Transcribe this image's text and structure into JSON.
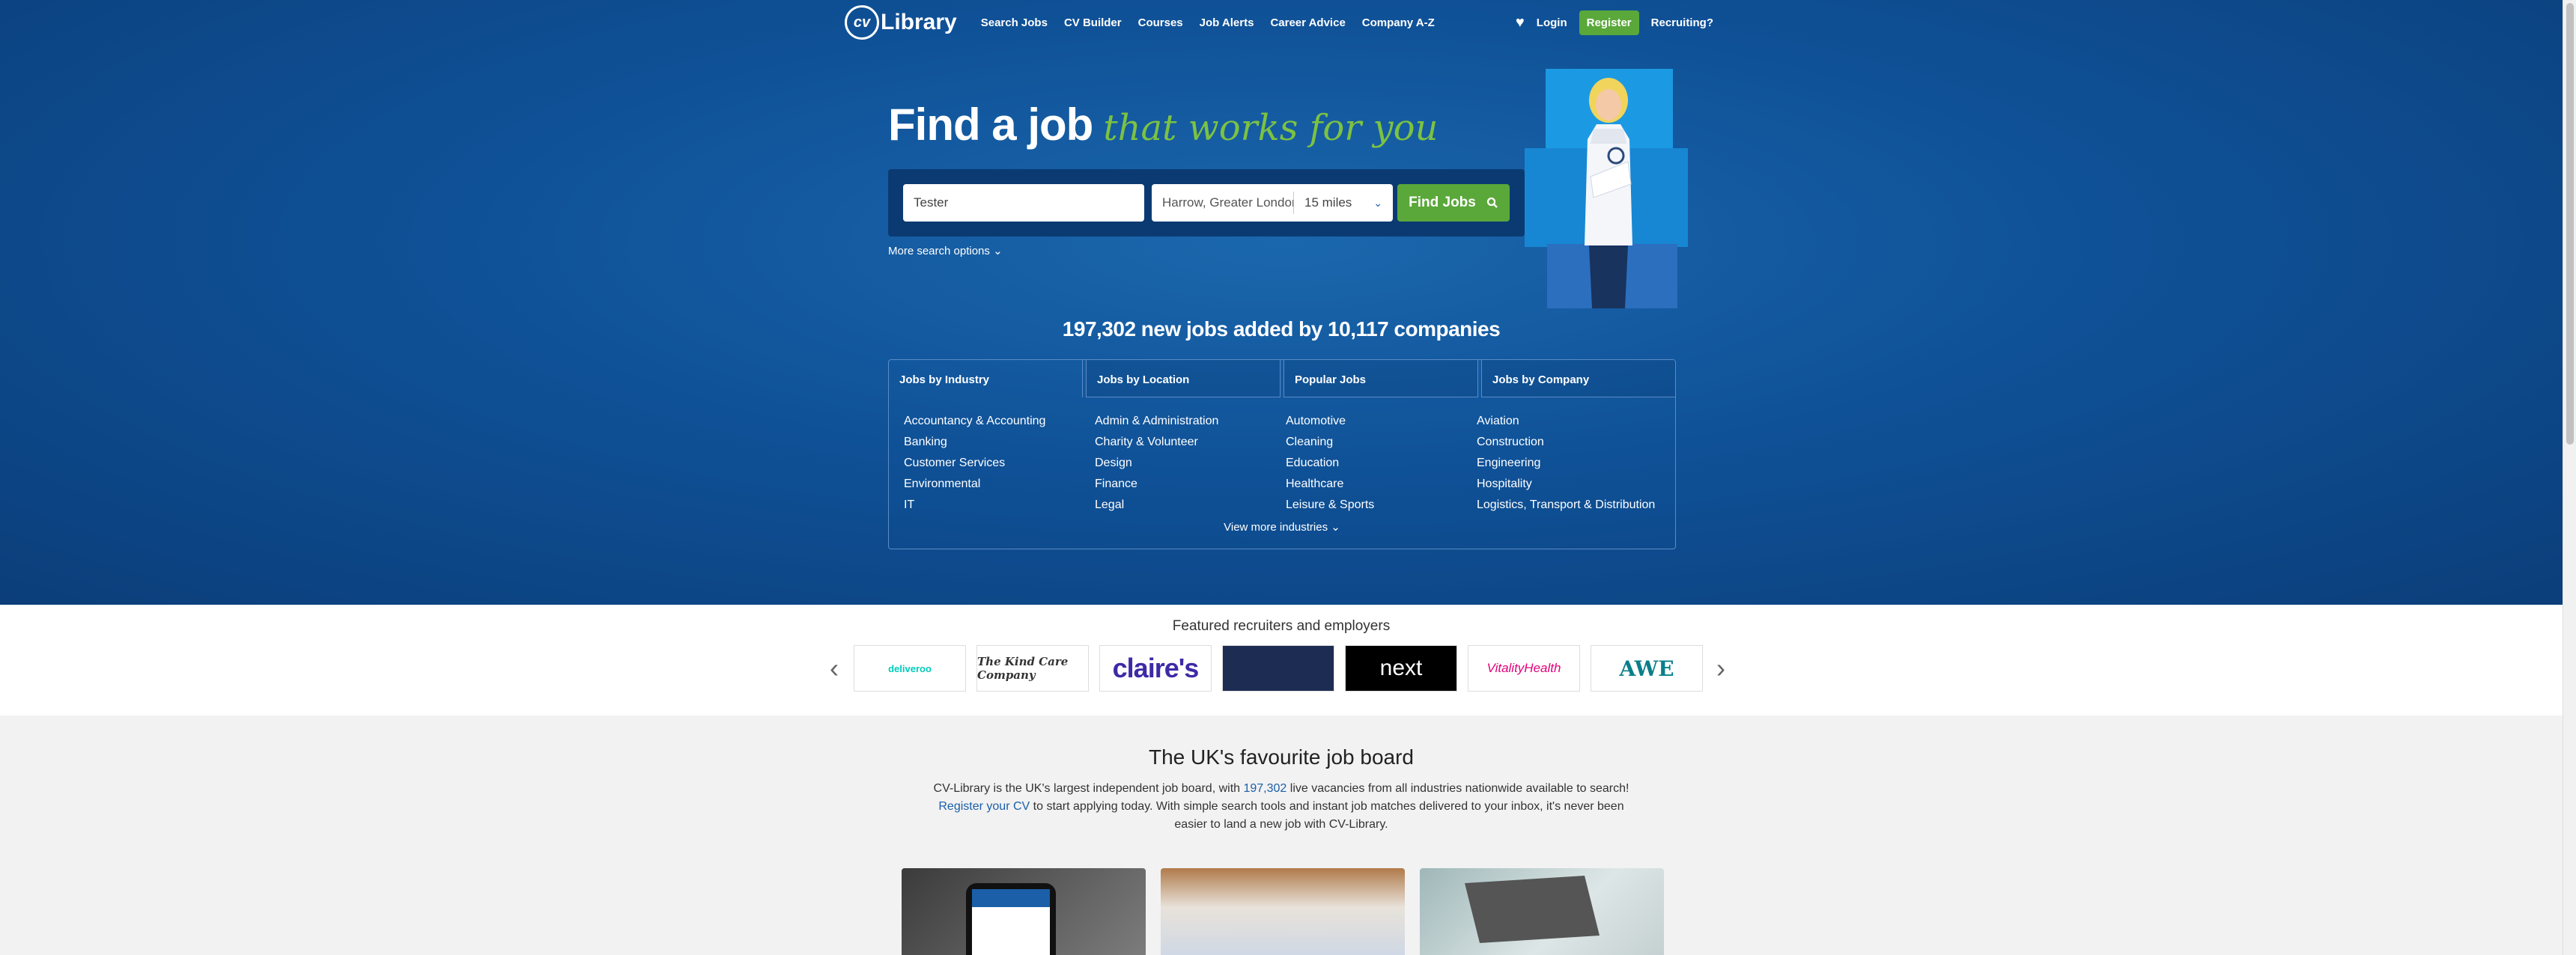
{
  "nav": {
    "logo": "Library",
    "logo_badge": "cv",
    "links": [
      "Search Jobs",
      "CV Builder",
      "Courses",
      "Job Alerts",
      "Career Advice",
      "Company A-Z"
    ],
    "login": "Login",
    "register": "Register",
    "recruiting": "Recruiting?"
  },
  "hero": {
    "title": "Find a job",
    "title_accent": "that works for you",
    "keyword_value": "Tester",
    "location_value": "Harrow, Greater London",
    "radius_value": "15 miles",
    "find_button": "Find Jobs",
    "more_options": "More search options"
  },
  "count_text": "197,302 new jobs added by 10,117 companies",
  "tabs": [
    "Jobs by Industry",
    "Jobs by Location",
    "Popular Jobs",
    "Jobs by Company"
  ],
  "industries": [
    [
      "Accountancy & Accounting",
      "Banking",
      "Customer Services",
      "Environmental",
      "IT"
    ],
    [
      "Admin & Administration",
      "Charity & Volunteer",
      "Design",
      "Finance",
      "Legal"
    ],
    [
      "Automotive",
      "Cleaning",
      "Education",
      "Healthcare",
      "Leisure & Sports"
    ],
    [
      "Aviation",
      "Construction",
      "Engineering",
      "Hospitality",
      "Logistics, Transport & Distribution"
    ]
  ],
  "view_more": "View more industries",
  "featured": {
    "title": "Featured recruiters and employers",
    "logos": [
      "deliveroo",
      "The Kind Care Company",
      "claire's",
      "",
      "next",
      "VitalityHealth",
      "AWE"
    ]
  },
  "about": {
    "title": "The UK's favourite job board",
    "p1": "CV-Library is the UK's largest independent job board, with ",
    "link1": "197,302",
    "p2": " live vacancies from all industries nationwide available to search! ",
    "link2": "Register your CV",
    "p3": " to start applying today. With simple search tools and instant job matches delivered to your inbox, it's never been easier to land a new job with CV-Library."
  }
}
